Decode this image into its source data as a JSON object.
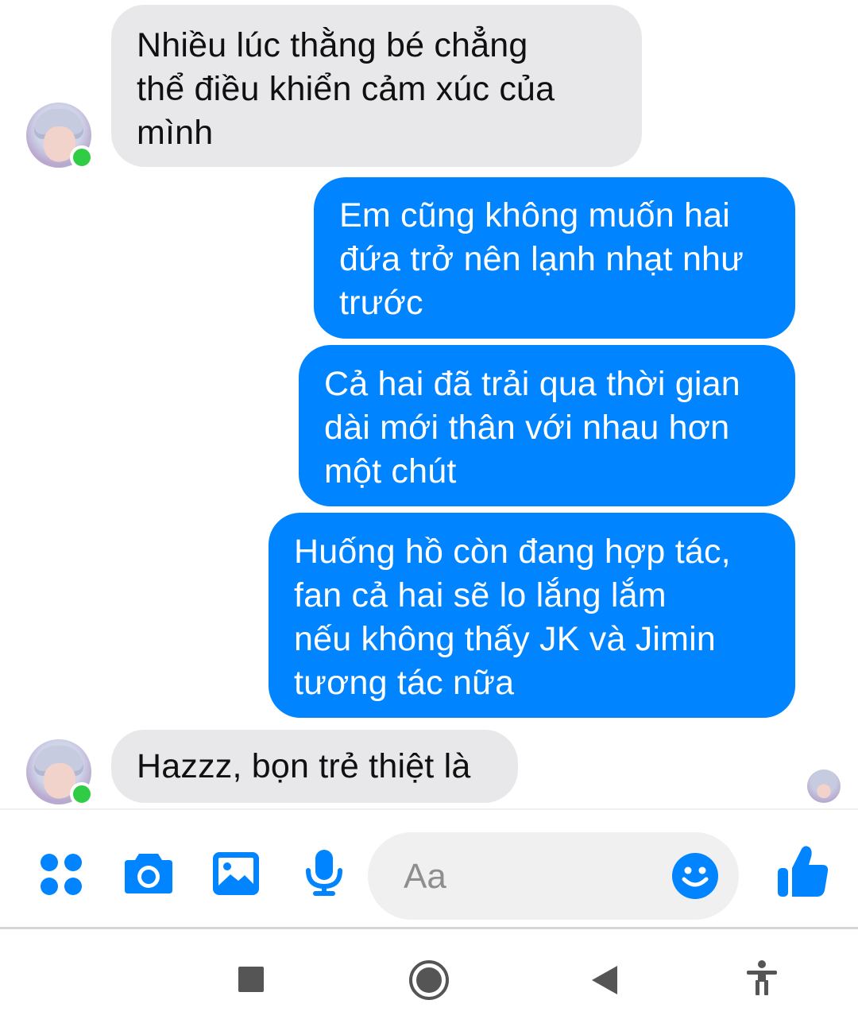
{
  "conversation": {
    "messages": [
      {
        "direction": "incoming",
        "text": "Nhiều lúc thằng bé chẳng\nthể điều khiển cảm xúc của\nmình"
      },
      {
        "direction": "outgoing",
        "text": "Em cũng không muốn hai\nđứa trở nên lạnh nhạt như\ntrước"
      },
      {
        "direction": "outgoing",
        "text": "Cả hai đã trải qua thời gian\ndài mới thân với nhau hơn\nmột chút"
      },
      {
        "direction": "outgoing",
        "text": "Huống hồ còn đang hợp tác,\nfan cả hai sẽ lo lắng lắm\nnếu không thấy JK và Jimin\ntương tác nữa"
      },
      {
        "direction": "incoming",
        "text": "Hazzz, bọn trẻ thiệt là"
      }
    ],
    "contact_status": "online"
  },
  "composer": {
    "placeholder": "Aa",
    "icons": [
      "apps-grid-icon",
      "camera-icon",
      "image-icon",
      "microphone-icon",
      "emoji-icon",
      "thumbs-up-icon"
    ],
    "accent_color": "#0084ff"
  },
  "system_nav": {
    "icons": [
      "recents-square-icon",
      "home-circle-icon",
      "back-triangle-icon",
      "accessibility-icon"
    ]
  },
  "colors": {
    "incoming_bubble": "#e8e8ea",
    "outgoing_bubble": "#0084ff",
    "online_dot": "#31cc46"
  }
}
